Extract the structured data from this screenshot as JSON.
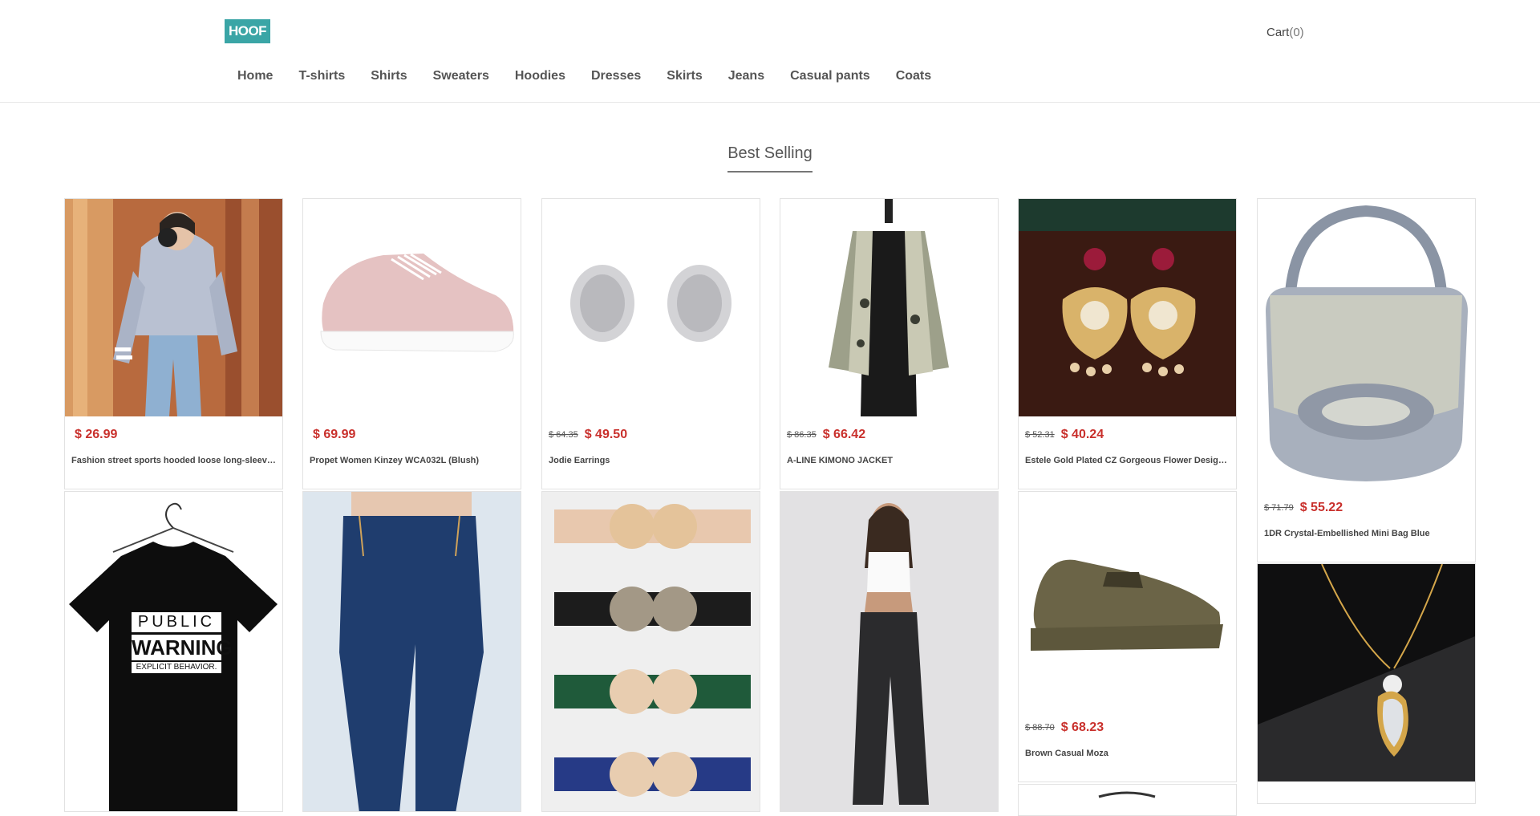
{
  "header": {
    "logo_text": "HOOF",
    "cart_label": "Cart",
    "cart_count": "(0)",
    "nav": [
      "Home",
      "T-shirts",
      "Shirts",
      "Sweaters",
      "Hoodies",
      "Dresses",
      "Skirts",
      "Jeans",
      "Casual pants",
      "Coats"
    ]
  },
  "section_title": "Best Selling",
  "products": [
    {
      "title": "Fashion street sports hooded loose long-sleeved sweater for women",
      "old_price": "",
      "price": "$ 26.99"
    },
    {
      "title": "Propet Women Kinzey WCA032L (Blush)",
      "old_price": "",
      "price": "$ 69.99"
    },
    {
      "title": "Jodie Earrings",
      "old_price": "$ 64.35",
      "price": "$ 49.50"
    },
    {
      "title": "A-LINE KIMONO JACKET",
      "old_price": "$ 86.35",
      "price": "$ 66.42"
    },
    {
      "title": "Estele Gold Plated CZ Gorgeous Flower Designer Earrings",
      "old_price": "$ 52.31",
      "price": "$ 40.24"
    },
    {
      "title": "1DR Crystal-Embellished Mini Bag Blue",
      "old_price": "$ 71.79",
      "price": "$ 55.22"
    },
    {
      "title": "Brown Casual Moza",
      "old_price": "$ 88.70",
      "price": "$ 68.23"
    }
  ],
  "tshirt_print": {
    "line1": "PUBLIC",
    "line2": "WARNING",
    "line3": "EXPLICIT BEHAVIOR."
  }
}
